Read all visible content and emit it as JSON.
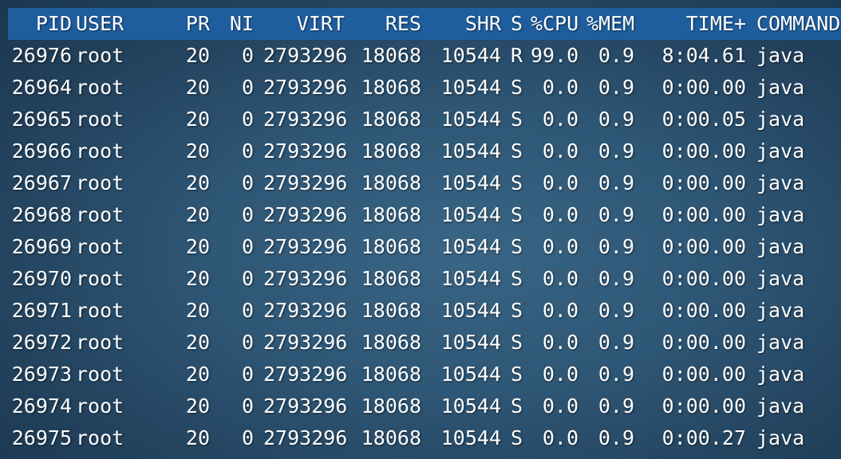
{
  "header": {
    "pid": "PID",
    "user": "USER",
    "pr": "PR",
    "ni": "NI",
    "virt": "VIRT",
    "res": "RES",
    "shr": "SHR",
    "s": "S",
    "cpu": "%CPU",
    "mem": "%MEM",
    "time": "TIME+",
    "command": "COMMAND"
  },
  "processes": [
    {
      "pid": "26976",
      "user": "root",
      "pr": "20",
      "ni": "0",
      "virt": "2793296",
      "res": "18068",
      "shr": "10544",
      "s": "R",
      "cpu": "99.0",
      "mem": "0.9",
      "time": "8:04.61",
      "command": "java"
    },
    {
      "pid": "26964",
      "user": "root",
      "pr": "20",
      "ni": "0",
      "virt": "2793296",
      "res": "18068",
      "shr": "10544",
      "s": "S",
      "cpu": "0.0",
      "mem": "0.9",
      "time": "0:00.00",
      "command": "java"
    },
    {
      "pid": "26965",
      "user": "root",
      "pr": "20",
      "ni": "0",
      "virt": "2793296",
      "res": "18068",
      "shr": "10544",
      "s": "S",
      "cpu": "0.0",
      "mem": "0.9",
      "time": "0:00.05",
      "command": "java"
    },
    {
      "pid": "26966",
      "user": "root",
      "pr": "20",
      "ni": "0",
      "virt": "2793296",
      "res": "18068",
      "shr": "10544",
      "s": "S",
      "cpu": "0.0",
      "mem": "0.9",
      "time": "0:00.00",
      "command": "java"
    },
    {
      "pid": "26967",
      "user": "root",
      "pr": "20",
      "ni": "0",
      "virt": "2793296",
      "res": "18068",
      "shr": "10544",
      "s": "S",
      "cpu": "0.0",
      "mem": "0.9",
      "time": "0:00.00",
      "command": "java"
    },
    {
      "pid": "26968",
      "user": "root",
      "pr": "20",
      "ni": "0",
      "virt": "2793296",
      "res": "18068",
      "shr": "10544",
      "s": "S",
      "cpu": "0.0",
      "mem": "0.9",
      "time": "0:00.00",
      "command": "java"
    },
    {
      "pid": "26969",
      "user": "root",
      "pr": "20",
      "ni": "0",
      "virt": "2793296",
      "res": "18068",
      "shr": "10544",
      "s": "S",
      "cpu": "0.0",
      "mem": "0.9",
      "time": "0:00.00",
      "command": "java"
    },
    {
      "pid": "26970",
      "user": "root",
      "pr": "20",
      "ni": "0",
      "virt": "2793296",
      "res": "18068",
      "shr": "10544",
      "s": "S",
      "cpu": "0.0",
      "mem": "0.9",
      "time": "0:00.00",
      "command": "java"
    },
    {
      "pid": "26971",
      "user": "root",
      "pr": "20",
      "ni": "0",
      "virt": "2793296",
      "res": "18068",
      "shr": "10544",
      "s": "S",
      "cpu": "0.0",
      "mem": "0.9",
      "time": "0:00.00",
      "command": "java"
    },
    {
      "pid": "26972",
      "user": "root",
      "pr": "20",
      "ni": "0",
      "virt": "2793296",
      "res": "18068",
      "shr": "10544",
      "s": "S",
      "cpu": "0.0",
      "mem": "0.9",
      "time": "0:00.00",
      "command": "java"
    },
    {
      "pid": "26973",
      "user": "root",
      "pr": "20",
      "ni": "0",
      "virt": "2793296",
      "res": "18068",
      "shr": "10544",
      "s": "S",
      "cpu": "0.0",
      "mem": "0.9",
      "time": "0:00.00",
      "command": "java"
    },
    {
      "pid": "26974",
      "user": "root",
      "pr": "20",
      "ni": "0",
      "virt": "2793296",
      "res": "18068",
      "shr": "10544",
      "s": "S",
      "cpu": "0.0",
      "mem": "0.9",
      "time": "0:00.00",
      "command": "java"
    },
    {
      "pid": "26975",
      "user": "root",
      "pr": "20",
      "ni": "0",
      "virt": "2793296",
      "res": "18068",
      "shr": "10544",
      "s": "S",
      "cpu": "0.0",
      "mem": "0.9",
      "time": "0:00.27",
      "command": "java"
    }
  ],
  "colors": {
    "header_bar": "#1f5e9e",
    "background": "#2e5675",
    "text": "#ffffff"
  }
}
